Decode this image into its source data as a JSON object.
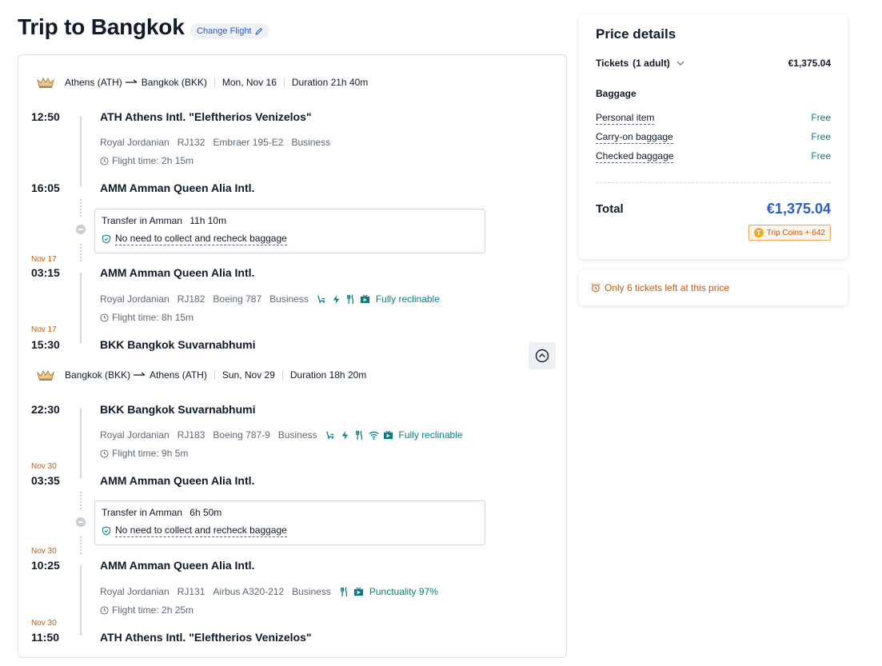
{
  "header": {
    "title": "Trip to Bangkok",
    "change_flight": "Change Flight"
  },
  "outbound": {
    "origin": "Athens (ATH)",
    "destination": "Bangkok (BKK)",
    "date": "Mon, Nov 16",
    "duration": "Duration 21h 40m",
    "leg1": {
      "dep_time": "12:50",
      "dep_airport": "ATH Athens Intl. \"Eleftherios Venizelos\"",
      "airline": "Royal Jordanian",
      "flight_no": "RJ132",
      "aircraft": "Embraer 195-E2",
      "cabin": "Business",
      "flight_time": "Flight time: 2h 15m",
      "arr_time": "16:05",
      "arr_airport": "AMM Amman Queen Alia Intl."
    },
    "transfer": {
      "label": "Transfer in Amman",
      "duration": "11h 10m",
      "baggage_note": "No need to collect and recheck baggage"
    },
    "leg2": {
      "dep_date": "Nov 17",
      "dep_time": "03:15",
      "dep_airport": "AMM Amman Queen Alia Intl.",
      "airline": "Royal Jordanian",
      "flight_no": "RJ182",
      "aircraft": "Boeing 787",
      "cabin": "Business",
      "amenity_label": "Fully reclinable",
      "flight_time": "Flight time: 8h 15m",
      "arr_date": "Nov 17",
      "arr_time": "15:30",
      "arr_airport": "BKK Bangkok Suvarnabhumi"
    }
  },
  "return": {
    "origin": "Bangkok (BKK)",
    "destination": "Athens (ATH)",
    "date": "Sun, Nov 29",
    "duration": "Duration 18h 20m",
    "leg1": {
      "dep_time": "22:30",
      "dep_airport": "BKK Bangkok Suvarnabhumi",
      "airline": "Royal Jordanian",
      "flight_no": "RJ183",
      "aircraft": "Boeing 787-9",
      "cabin": "Business",
      "amenity_label": "Fully reclinable",
      "flight_time": "Flight time: 9h 5m",
      "arr_date": "Nov 30",
      "arr_time": "03:35",
      "arr_airport": "AMM Amman Queen Alia Intl."
    },
    "transfer": {
      "label": "Transfer in Amman",
      "duration": "6h 50m",
      "baggage_note": "No need to collect and recheck baggage"
    },
    "leg2": {
      "dep_date": "Nov 30",
      "dep_time": "10:25",
      "dep_airport": "AMM Amman Queen Alia Intl.",
      "airline": "Royal Jordanian",
      "flight_no": "RJ131",
      "aircraft": "Airbus A320-212",
      "cabin": "Business",
      "amenity_label": "Punctuality 97%",
      "flight_time": "Flight time: 2h 25m",
      "arr_date": "Nov 30",
      "arr_time": "11:50",
      "arr_airport": "ATH Athens Intl. \"Eleftherios Venizelos\""
    }
  },
  "price": {
    "title": "Price details",
    "tickets_label": "Tickets",
    "tickets_qty": "(1 adult)",
    "tickets_price": "€1,375.04",
    "baggage_title": "Baggage",
    "baggage": [
      {
        "label": "Personal item",
        "value": "Free"
      },
      {
        "label": "Carry-on baggage",
        "value": "Free"
      },
      {
        "label": "Checked baggage",
        "value": "Free"
      }
    ],
    "total_label": "Total",
    "total_value": "€1,375.04",
    "coins": "Trip Coins + 642",
    "coin_icon": "T"
  },
  "alert": {
    "text": "Only 6 tickets left at this price"
  },
  "colors": {
    "accent_blue": "#2c5cc5",
    "amenity_teal": "#0b7b7e",
    "alert_orange": "#c05a14"
  }
}
